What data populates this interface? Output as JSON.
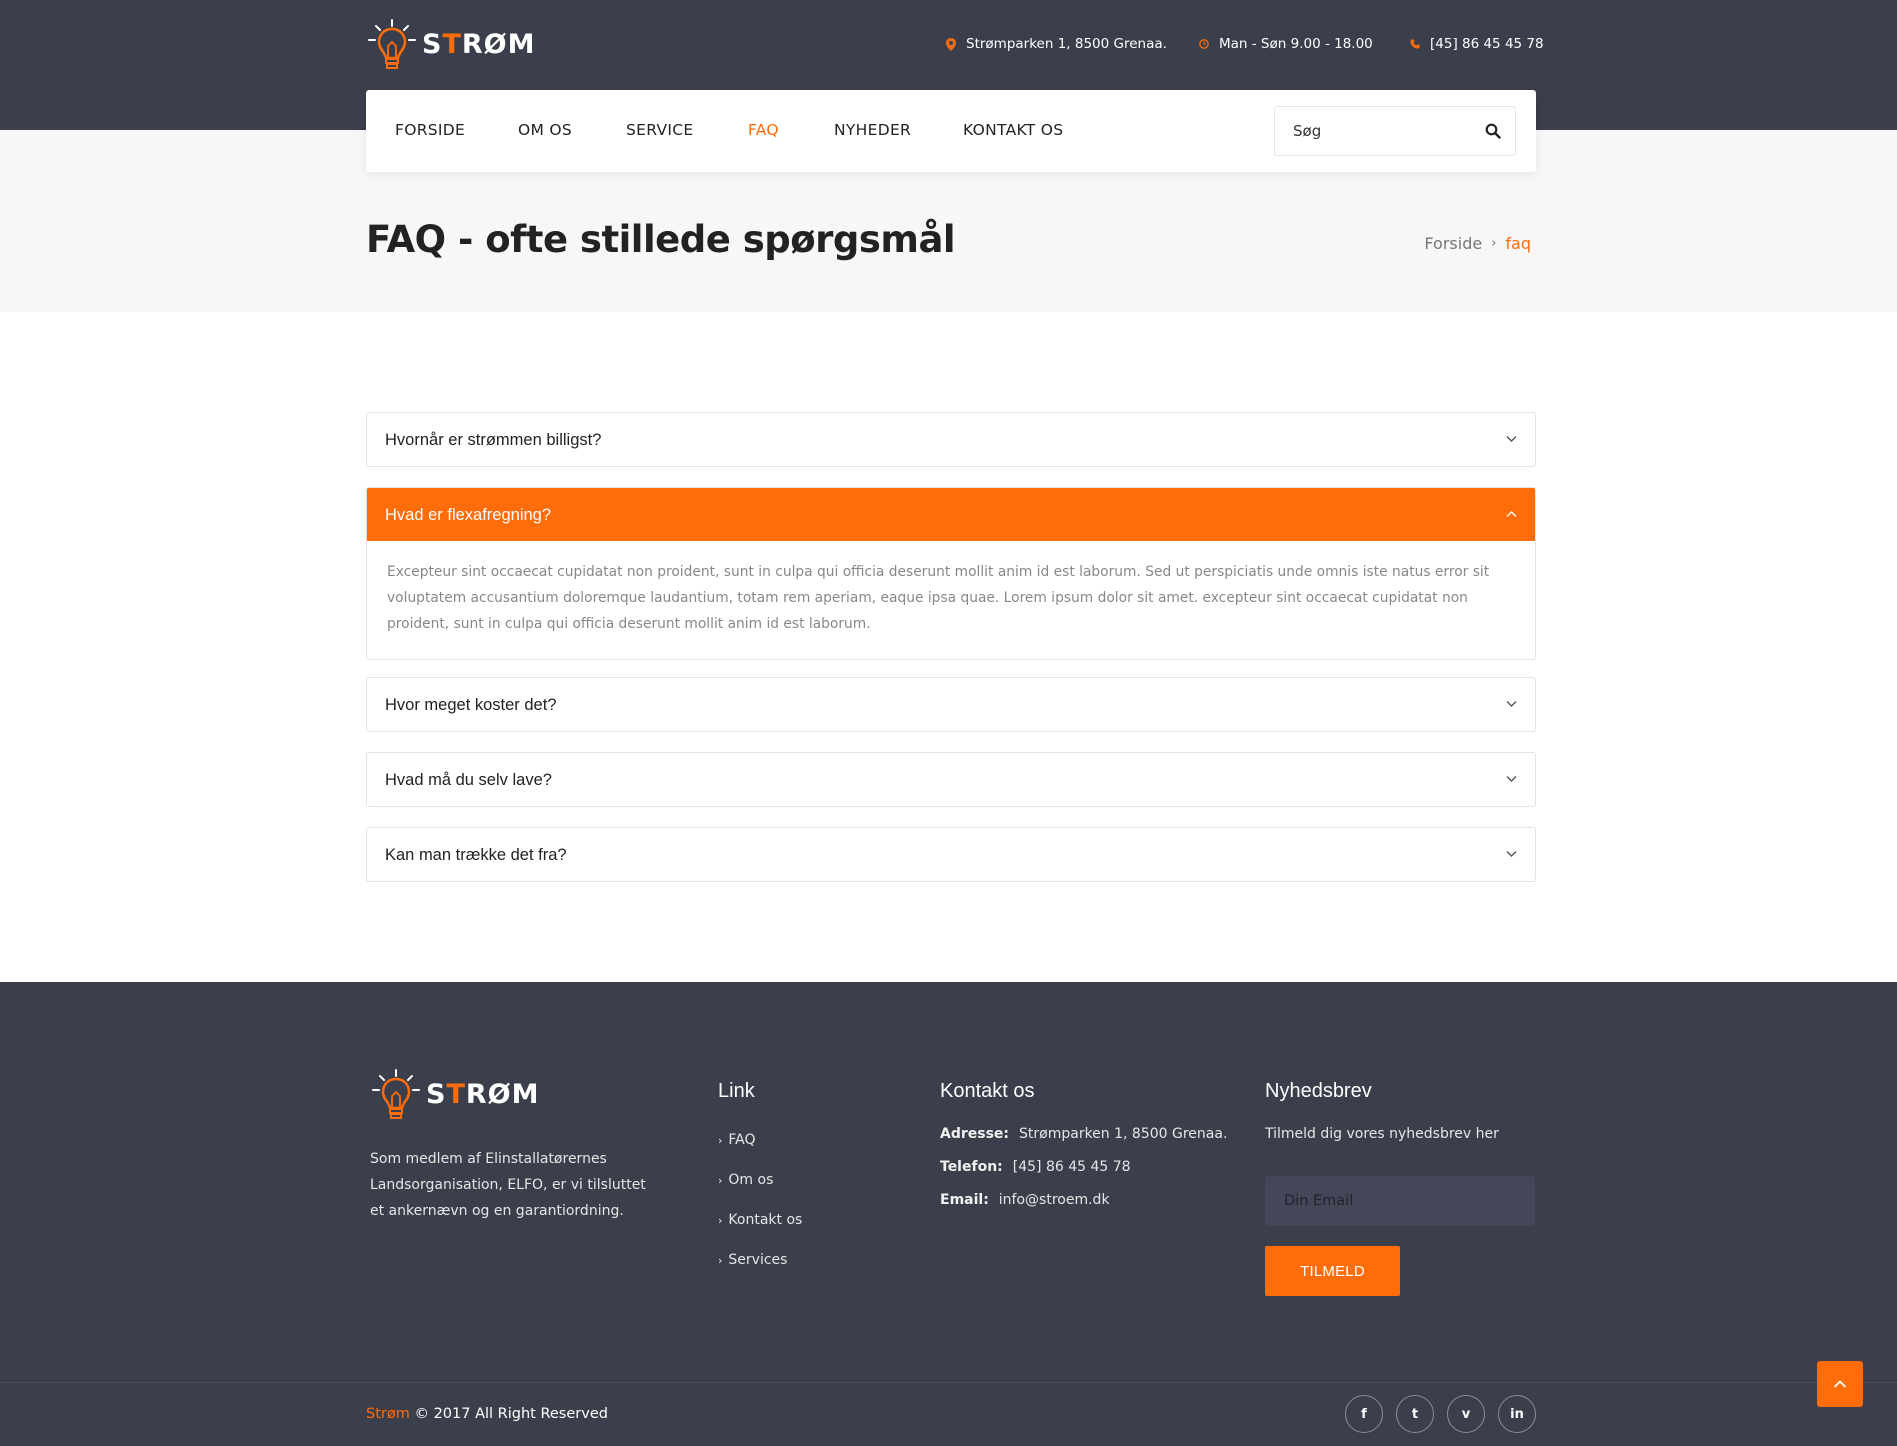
{
  "brand": {
    "logo_text_pre": "S",
    "logo_text_accent": "T",
    "logo_text_post": "RØM"
  },
  "header": {
    "address": "Strømparken 1, 8500 Grenaa.",
    "hours": "Man - Søn 9.00 - 18.00",
    "phone": "[45] 86 45 45 78"
  },
  "nav": {
    "items": [
      {
        "label": "FORSIDE"
      },
      {
        "label": "OM OS"
      },
      {
        "label": "SERVICE"
      },
      {
        "label": "FAQ",
        "active": true
      },
      {
        "label": "NYHEDER"
      },
      {
        "label": "KONTAKT OS"
      }
    ],
    "search_placeholder": "Søg"
  },
  "page": {
    "title": "FAQ - ofte stillede spørgsmål",
    "breadcrumb_home": "Forside",
    "breadcrumb_sep": "›",
    "breadcrumb_current": "faq"
  },
  "faq": [
    {
      "question": "Hvornår er strømmen billigst?",
      "open": false
    },
    {
      "question": "Hvad er flexafregning?",
      "open": true,
      "answer": "Excepteur sint occaecat cupidatat non proident, sunt in culpa qui officia deserunt mollit anim id est laborum. Sed ut perspiciatis unde omnis iste natus error sit voluptatem accusantium doloremque laudantium, totam rem aperiam, eaque ipsa quae. Lorem ipsum dolor sit amet. excepteur sint occaecat cupidatat non proident, sunt in culpa qui officia deserunt mollit anim id est laborum."
    },
    {
      "question": "Hvor meget koster det?",
      "open": false
    },
    {
      "question": "Hvad må du selv lave?",
      "open": false
    },
    {
      "question": "Kan man trække det fra?",
      "open": false
    }
  ],
  "footer": {
    "about": "Som medlem af Elinstallatørernes Landsorganisation, ELFO, er vi tilsluttet et ankernævn og en garantiordning.",
    "links_title": "Link",
    "links": [
      "FAQ",
      "Om os",
      "Kontakt os",
      "Services"
    ],
    "contact_title": "Kontakt os",
    "contact": {
      "address_label": "Adresse:",
      "address": "Strømparken 1, 8500 Grenaa.",
      "phone_label": "Telefon:",
      "phone": "[45] 86 45 45 78",
      "email_label": "Email:",
      "email": "info@stroem.dk"
    },
    "newsletter_title": "Nyhedsbrev",
    "newsletter_desc": "Tilmeld dig vores nyhedsbrev her",
    "email_placeholder": "Din Email",
    "subscribe_label": "TILMELD",
    "copyright_brand": "Strøm",
    "copyright_text": " © 2017 All Right Reserved",
    "social": [
      {
        "icon": "facebook-icon",
        "glyph": "f"
      },
      {
        "icon": "twitter-icon",
        "glyph": "t"
      },
      {
        "icon": "vimeo-icon",
        "glyph": "v"
      },
      {
        "icon": "linkedin-icon",
        "glyph": "in"
      }
    ]
  },
  "colors": {
    "accent": "#ff6c0a",
    "dark": "#3b3e4b",
    "light_bg": "#f7f7f8"
  }
}
